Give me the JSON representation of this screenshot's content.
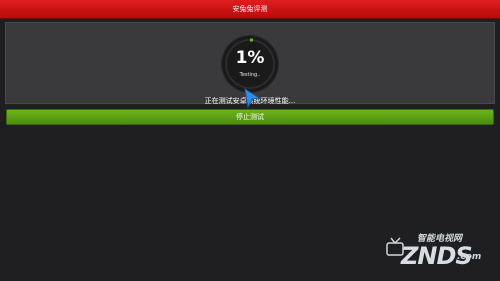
{
  "header": {
    "title": "安兔兔评测"
  },
  "gauge": {
    "percent_label": "1%",
    "progress": 0.01,
    "status_label": "Testing.."
  },
  "status": {
    "message": "正在测试安卓系统环境性能..."
  },
  "actions": {
    "stop_label": "停止测试"
  },
  "watermark": {
    "cn": "智能电视网",
    "brand": "ZNDS",
    "suffix": ".com"
  },
  "colors": {
    "header": "#d01414",
    "button": "#5ea118",
    "progress": "#5fbf2a",
    "background": "#1f1f21",
    "panel": "#3a3a3d"
  }
}
